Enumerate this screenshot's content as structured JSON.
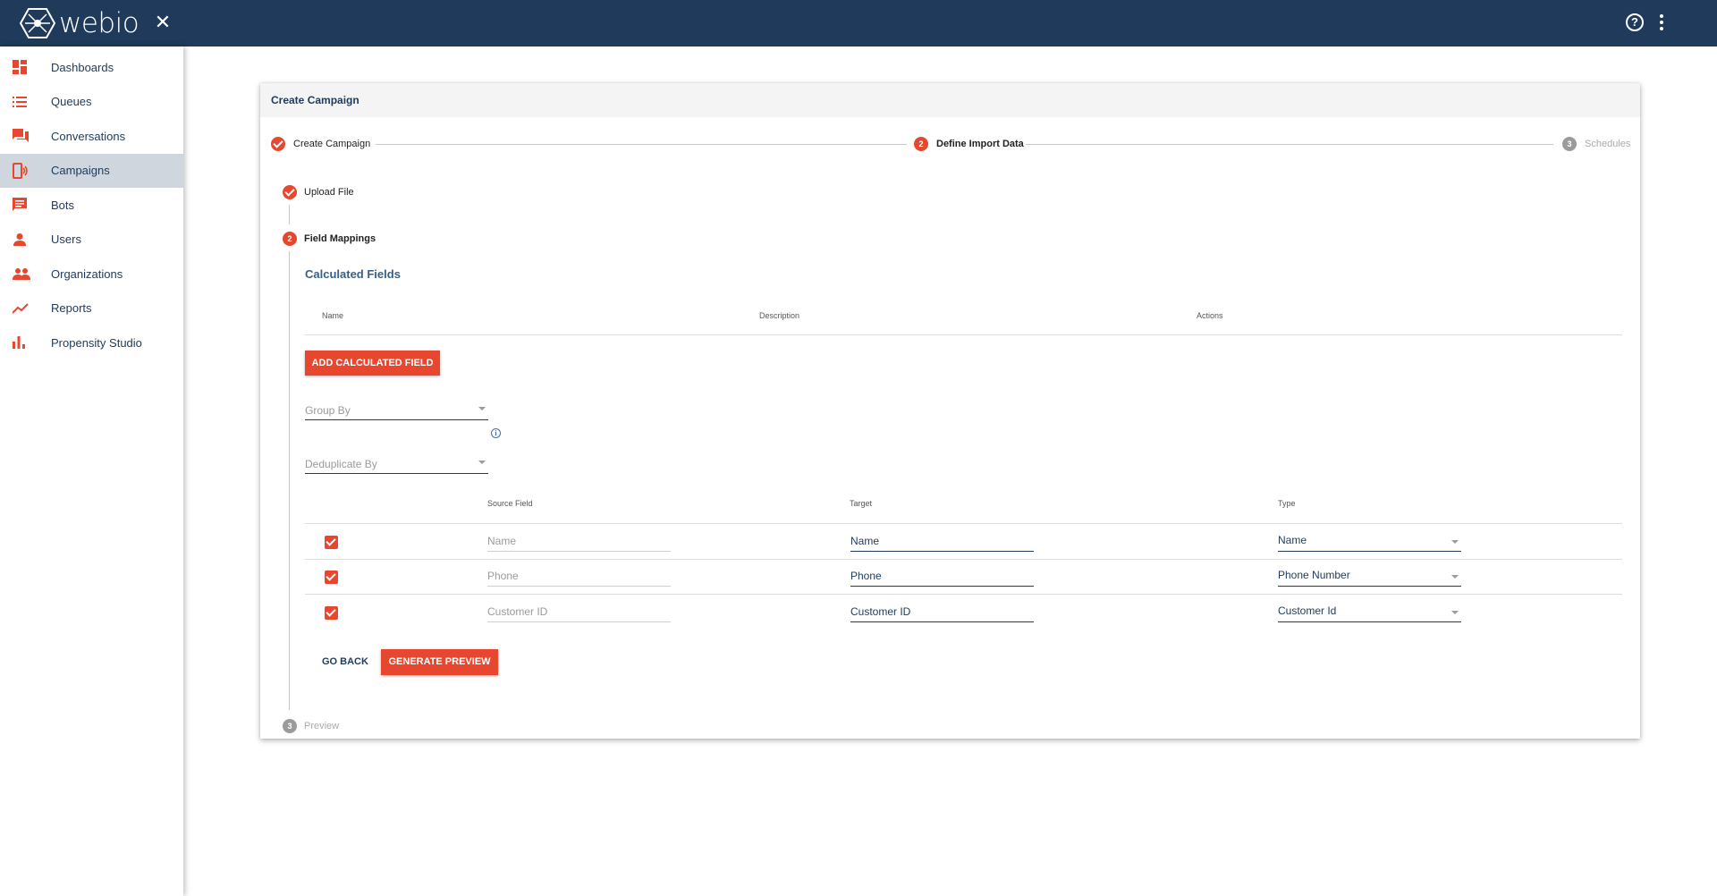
{
  "header": {
    "brand": "webio",
    "close_icon": "close-icon",
    "help_icon": "help-circle-icon",
    "more_icon": "more-vertical-icon"
  },
  "sidebar": {
    "items": [
      {
        "label": "Dashboards",
        "icon": "dashboard-icon"
      },
      {
        "label": "Queues",
        "icon": "list-icon"
      },
      {
        "label": "Conversations",
        "icon": "chat-icon"
      },
      {
        "label": "Campaigns",
        "icon": "campaign-icon",
        "active": true
      },
      {
        "label": "Bots",
        "icon": "message-icon"
      },
      {
        "label": "Users",
        "icon": "user-icon"
      },
      {
        "label": "Organizations",
        "icon": "group-icon"
      },
      {
        "label": "Reports",
        "icon": "trend-icon"
      },
      {
        "label": "Propensity Studio",
        "icon": "bar-chart-icon"
      }
    ]
  },
  "card": {
    "title": "Create Campaign",
    "steps": [
      {
        "label": "Create Campaign",
        "state": "done"
      },
      {
        "label": "Define Import Data",
        "number": "2",
        "state": "active"
      },
      {
        "label": "Schedules",
        "number": "3",
        "state": "pending"
      }
    ],
    "substeps": [
      {
        "label": "Upload File",
        "state": "done"
      },
      {
        "label": "Field Mappings",
        "number": "2",
        "state": "active"
      },
      {
        "label": "Preview",
        "number": "3",
        "state": "pending"
      }
    ],
    "calculated": {
      "title": "Calculated Fields",
      "columns": [
        "Name",
        "Description",
        "Actions"
      ],
      "add_button": "ADD CALCULATED FIELD"
    },
    "group_by": {
      "placeholder": "Group By"
    },
    "deduplicate_by": {
      "placeholder": "Deduplicate By"
    },
    "mapping": {
      "columns": [
        "Source Field",
        "Target",
        "Type"
      ],
      "rows": [
        {
          "checked": true,
          "source": "Name",
          "target": "Name",
          "type": "Name"
        },
        {
          "checked": true,
          "source": "Phone",
          "target": "Phone",
          "type": "Phone Number"
        },
        {
          "checked": true,
          "source": "Customer ID",
          "target": "Customer ID",
          "type": "Customer Id"
        }
      ]
    },
    "go_back": "GO BACK",
    "generate_preview": "GENERATE PREVIEW"
  },
  "colors": {
    "topbar": "#1f3a5a",
    "accent": "#e8472f",
    "sidebar_active": "#cfd6dd"
  }
}
